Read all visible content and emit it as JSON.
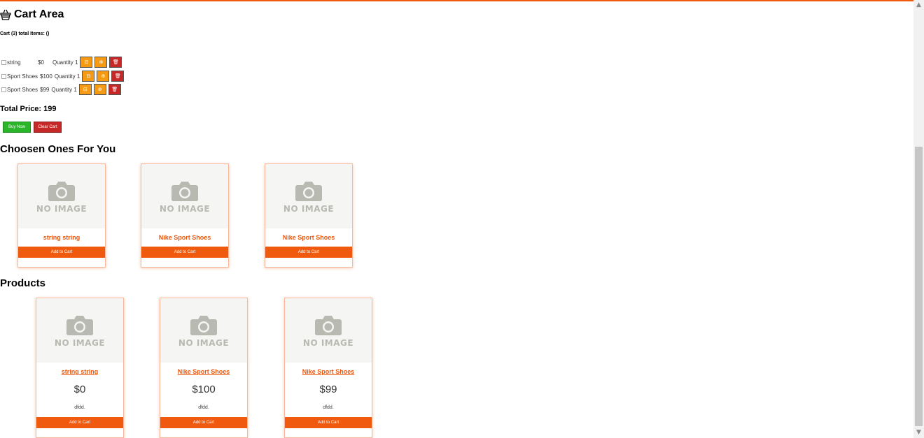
{
  "cart": {
    "title": "Cart Area",
    "summary": "Cart (3) total Items: ()",
    "items": [
      {
        "name": "string",
        "price": "$0",
        "quantity": "Quantity 1"
      },
      {
        "name": "Sport Shoes",
        "price": "$100",
        "quantity": "Quantity 1"
      },
      {
        "name": "Sport Shoes",
        "price": "$99",
        "quantity": "Quantity 1"
      }
    ],
    "total": "Total Price: 199",
    "buy_label": "Buy Now",
    "clear_label": "Clear Cart"
  },
  "chosen": {
    "title": "Choosen Ones For You",
    "items": [
      {
        "name": "string string",
        "image_text": "NO IMAGE",
        "button": "Add to Cart"
      },
      {
        "name": "Nike Sport Shoes",
        "image_text": "NO IMAGE",
        "button": "Add to Cart"
      },
      {
        "name": "Nike Sport Shoes",
        "image_text": "NO IMAGE",
        "button": "Add to Cart"
      }
    ]
  },
  "products": {
    "title": "Products",
    "items": [
      {
        "name": "string string",
        "price": "$0",
        "description": "dfdd.",
        "image_text": "NO IMAGE",
        "button": "Add to Cart"
      },
      {
        "name": "Nike Sport Shoes",
        "price": "$100",
        "description": "dfdd.",
        "image_text": "NO IMAGE",
        "button": "Add to Cart"
      },
      {
        "name": "Nike Sport Shoes",
        "price": "$99",
        "description": "dfdd.",
        "image_text": "NO IMAGE",
        "button": "Add to Cart"
      }
    ]
  },
  "colors": {
    "accent": "#f05a0e",
    "buy": "#2ab52a",
    "danger": "#c62828",
    "action": "#f59a12"
  }
}
